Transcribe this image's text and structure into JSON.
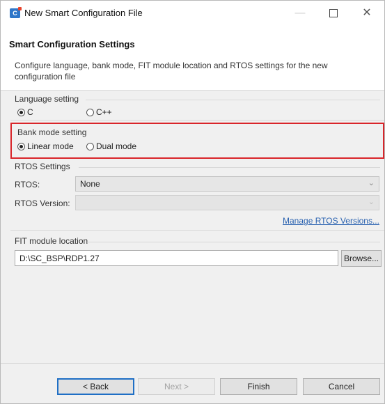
{
  "window": {
    "title": "New Smart Configuration File",
    "app_icon": "renesas-smart-configurator-icon",
    "minimize_glyph": "—",
    "close_glyph": "✕"
  },
  "header": {
    "title": "Smart Configuration Settings",
    "description": "Configure language, bank mode, FIT module location and RTOS settings for the new configuration file"
  },
  "language": {
    "label": "Language setting",
    "options": [
      {
        "label": "C",
        "checked": true
      },
      {
        "label": "C++",
        "checked": false
      }
    ]
  },
  "bank_mode": {
    "label": "Bank mode setting",
    "options": [
      {
        "label": "Linear mode",
        "checked": true
      },
      {
        "label": "Dual mode",
        "checked": false
      }
    ],
    "highlight_color": "#d9252a"
  },
  "rtos": {
    "label": "RTOS Settings",
    "rtos_label": "RTOS:",
    "rtos_value": "None",
    "version_label": "RTOS Version:",
    "version_value": "",
    "manage_link": "Manage RTOS Versions...",
    "dropdown_glyph": "⌄"
  },
  "fit": {
    "label": "FIT module location",
    "path": "D:\\SC_BSP\\RDP1.27",
    "browse_label": "Browse..."
  },
  "footer": {
    "back_label": "< Back",
    "next_label": "Next >",
    "finish_label": "Finish",
    "cancel_label": "Cancel"
  }
}
